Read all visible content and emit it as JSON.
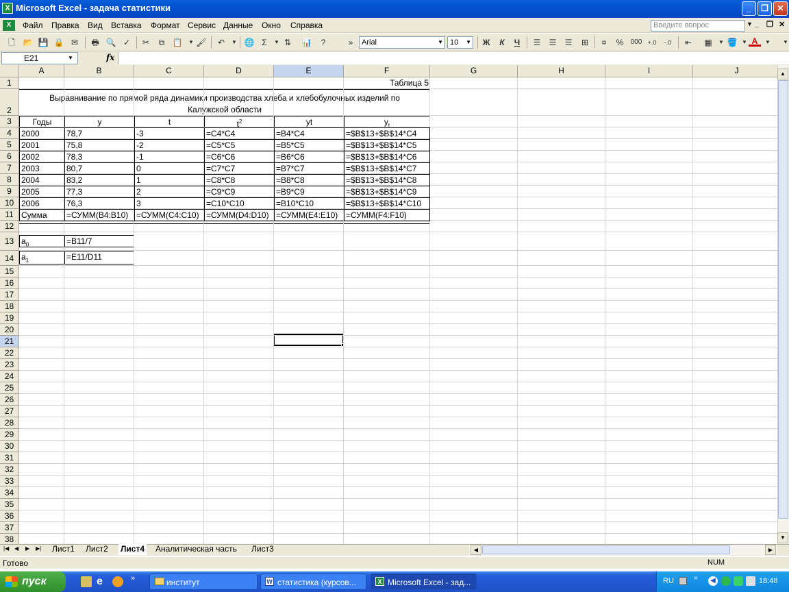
{
  "window": {
    "title": "Microsoft Excel - задача статистики"
  },
  "menu": {
    "items": [
      "Файл",
      "Правка",
      "Вид",
      "Вставка",
      "Формат",
      "Сервис",
      "Данные",
      "Окно",
      "Справка"
    ],
    "help_placeholder": "Введите вопрос"
  },
  "toolbar": {
    "font": "Arial",
    "size": "10",
    "bold": "Ж",
    "italic": "К",
    "underline": "Ч",
    "percent": "%",
    "thousands": "000"
  },
  "formula_bar": {
    "name_box": "E21",
    "fx": "fx",
    "formula": ""
  },
  "columns": [
    "A",
    "B",
    "C",
    "D",
    "E",
    "F",
    "G",
    "H",
    "I",
    "J"
  ],
  "selected_cell": "E21",
  "sheet": {
    "F1": "Таблица 5",
    "title_line1": "Выравнивание по прямой ряда динамики производства хлеба и хлебобулочных изделий по",
    "title_line2": "Калужской области",
    "headers": {
      "A": "Годы",
      "B": "y",
      "C": "t",
      "D_base": "t",
      "D_sup": "2",
      "E": "yt",
      "F_base": "y",
      "F_sub": "t"
    },
    "rows": [
      [
        "2000",
        "78,7",
        "-3",
        "=C4*C4",
        "=B4*C4",
        "=$B$13+$B$14*C4"
      ],
      [
        "2001",
        "75,8",
        "-2",
        "=C5*C5",
        "=B5*C5",
        "=$B$13+$B$14*C5"
      ],
      [
        "2002",
        "78,3",
        "-1",
        "=C6*C6",
        "=B6*C6",
        "=$B$13+$B$14*C6"
      ],
      [
        "2003",
        "80,7",
        "0",
        "=C7*C7",
        "=B7*C7",
        "=$B$13+$B$14*C7"
      ],
      [
        "2004",
        "83,2",
        "1",
        "=C8*C8",
        "=B8*C8",
        "=$B$13+$B$14*C8"
      ],
      [
        "2005",
        "77,3",
        "2",
        "=C9*C9",
        "=B9*C9",
        "=$B$13+$B$14*C9"
      ],
      [
        "2006",
        "76,3",
        "3",
        "=C10*C10",
        "=B10*C10",
        "=$B$13+$B$14*C10"
      ]
    ],
    "sum_row": [
      "Сумма",
      "=СУММ(B4:B10)",
      "=СУММ(C4:C10)",
      "=СУММ(D4:D10)",
      "=СУММ(E4:E10)",
      "=СУММ(F4:F10)"
    ],
    "a0_base": "a",
    "a0_sub": "0",
    "a0_formula": "=B11/7",
    "a1_base": "a",
    "a1_sub": "1",
    "a1_formula": "=E11/D11"
  },
  "sheet_tabs": [
    "Лист1",
    "Лист2",
    "Лист4",
    "Аналитическая часть",
    "Лист3"
  ],
  "active_tab": "Лист4",
  "status": {
    "left": "Готово",
    "num": "NUM"
  },
  "taskbar": {
    "start": "пуск",
    "tasks": [
      "институт",
      "статистика (курсов...",
      "Microsoft Excel - зад..."
    ],
    "active_task": "Microsoft Excel - зад...",
    "lang": "RU",
    "clock": "18:48"
  }
}
